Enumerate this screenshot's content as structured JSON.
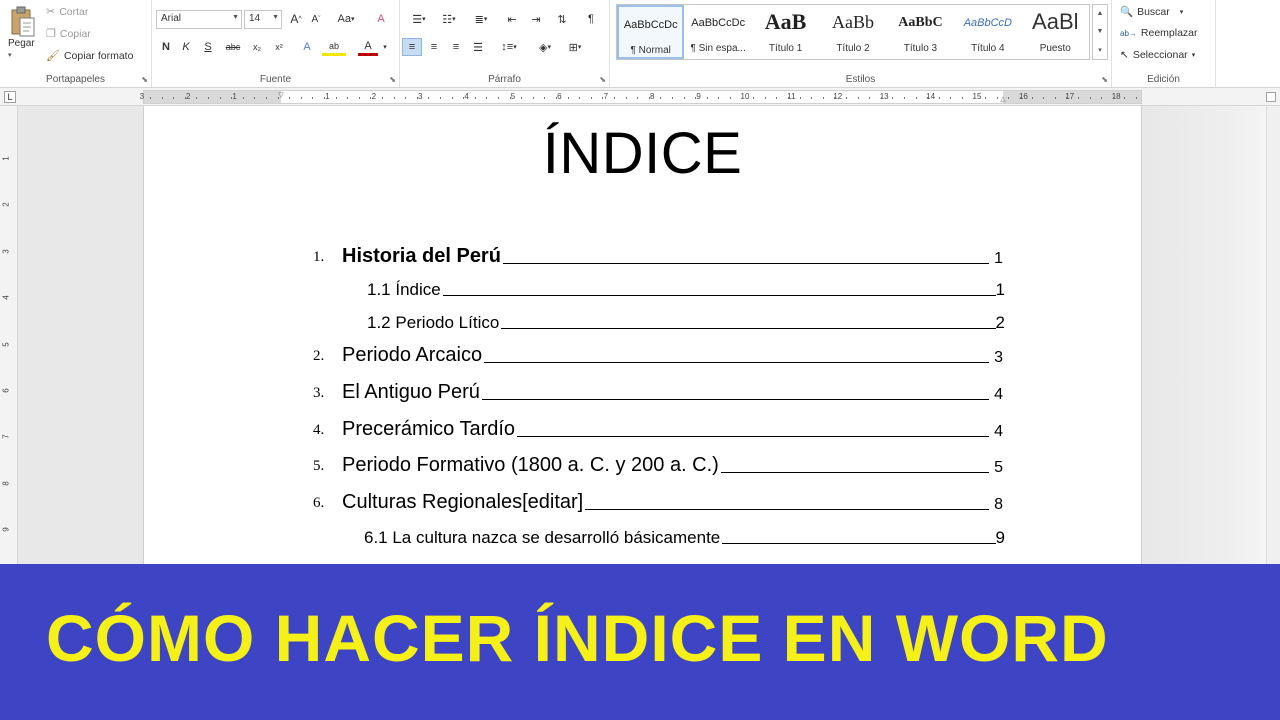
{
  "ribbon": {
    "clipboard": {
      "group_label": "Portapapeles",
      "paste_label": "Pegar",
      "cut_label": "Cortar",
      "copy_label": "Copiar",
      "format_painter_label": "Copiar formato"
    },
    "font": {
      "group_label": "Fuente",
      "font_name": "Arial",
      "font_size": "14",
      "bold": "N",
      "italic": "K",
      "underline": "S",
      "strikethrough": "abc",
      "subscript": "x₂",
      "superscript": "x²",
      "grow": "A",
      "shrink": "A",
      "case": "Aa",
      "clear": "A",
      "text_effects": "A",
      "highlight": "ab",
      "font_color": "A"
    },
    "paragraph": {
      "group_label": "Párrafo"
    },
    "styles": {
      "group_label": "Estilos",
      "items": [
        {
          "sample": "AaBbCcDc",
          "name": "¶ Normal"
        },
        {
          "sample": "AaBbCcDc",
          "name": "¶ Sin espa..."
        },
        {
          "sample": "AaB",
          "name": "Título 1"
        },
        {
          "sample": "AaBb",
          "name": "Título 2"
        },
        {
          "sample": "AaBbC",
          "name": "Título 3"
        },
        {
          "sample": "AaBbCcD",
          "name": "Título 4"
        },
        {
          "sample": "AaBl",
          "name": "Puesto"
        }
      ]
    },
    "editing": {
      "group_label": "Edición",
      "find_label": "Buscar",
      "replace_label": "Reemplazar",
      "select_label": "Seleccionar"
    }
  },
  "ruler": {
    "left_numbers": [
      "3",
      "2",
      "1"
    ],
    "right_numbers": [
      "1",
      "2",
      "3",
      "4",
      "5",
      "6",
      "7",
      "8",
      "9",
      "10",
      "11",
      "12",
      "13",
      "14",
      "15",
      "16",
      "17",
      "18"
    ],
    "vertical_numbers": [
      "1",
      "2",
      "3",
      "4",
      "5",
      "6",
      "7",
      "8",
      "9"
    ]
  },
  "document": {
    "title": "ÍNDICE",
    "toc": [
      {
        "num": "1.",
        "text": "Historia del Perú",
        "page": "1",
        "level": 1,
        "bold": true
      },
      {
        "num": "",
        "text": "1.1 Índice",
        "page": "1",
        "level": 2,
        "bold": false
      },
      {
        "num": "",
        "text": "1.2 Periodo Lítico",
        "page": "2",
        "level": 2,
        "bold": false
      },
      {
        "num": "2.",
        "text": "Periodo Arcaico",
        "page": "3",
        "level": 1,
        "bold": false
      },
      {
        "num": "3.",
        "text": "El Antiguo Perú",
        "page": "4",
        "level": 1,
        "bold": false
      },
      {
        "num": "4.",
        "text": "Precerámico Tardío",
        "page": "4",
        "level": 1,
        "bold": false
      },
      {
        "num": "5.",
        "text": "Periodo Formativo (1800 a. C. y 200 a. C.)",
        "page": "5",
        "level": 1,
        "bold": false
      },
      {
        "num": "6.",
        "text": "Culturas Regionales[editar]",
        "page": "8",
        "level": 1,
        "bold": false
      },
      {
        "num": "",
        "text": "6.1 La cultura nazca se desarrolló básicamente",
        "page": "9",
        "level": 2,
        "bold": false
      }
    ]
  },
  "banner": {
    "title": "CÓMO HACER ÍNDICE EN WORD",
    "background_color": "#3e45c4",
    "text_color": "#f5f017"
  }
}
